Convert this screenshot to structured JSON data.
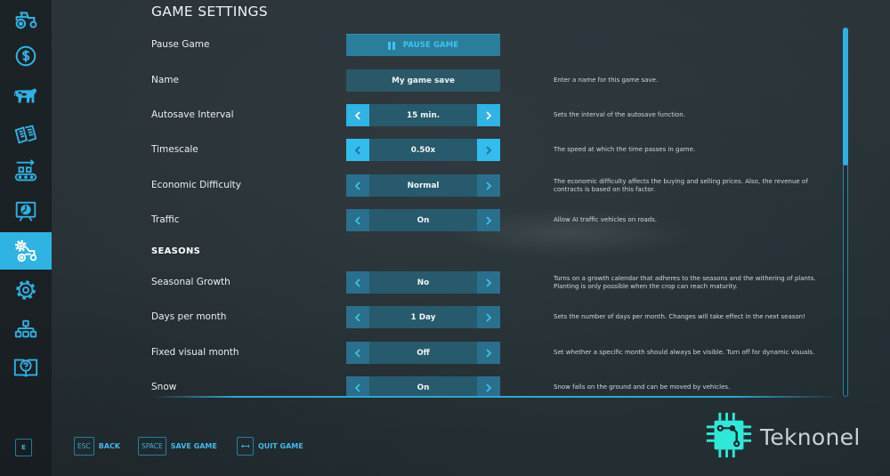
{
  "colors": {
    "accent": "#2fb4e4",
    "sidebar_bg": "#1a2024",
    "control_bg": "#265a6c",
    "watermark_accent": "#2ee8d8"
  },
  "sidebar": {
    "items": [
      {
        "id": "vehicles",
        "icon": "tractor-icon",
        "active": false
      },
      {
        "id": "finances",
        "icon": "dollar-icon",
        "active": false
      },
      {
        "id": "animals",
        "icon": "cow-icon",
        "active": false
      },
      {
        "id": "contracts",
        "icon": "papers-icon",
        "active": false
      },
      {
        "id": "production",
        "icon": "conveyor-icon",
        "active": false
      },
      {
        "id": "statistics",
        "icon": "presentation-icon",
        "active": false
      },
      {
        "id": "game-settings",
        "icon": "gear-tractor-icon",
        "active": true
      },
      {
        "id": "general-settings",
        "icon": "gear-icon",
        "active": false
      },
      {
        "id": "hierarchy",
        "icon": "hierarchy-icon",
        "active": false
      },
      {
        "id": "help",
        "icon": "help-book-icon",
        "active": false
      }
    ],
    "key_hint": "E"
  },
  "page": {
    "title": "GAME SETTINGS"
  },
  "settings": [
    {
      "id": "pause-game",
      "type": "button",
      "label": "Pause Game",
      "button_label": "PAUSE GAME",
      "icon": "pause-icon",
      "description": ""
    },
    {
      "id": "name",
      "type": "input",
      "label": "Name",
      "value": "My game save",
      "description": "Enter a name for this game save."
    },
    {
      "id": "autosave-interval",
      "type": "stepper",
      "state": "active",
      "label": "Autosave Interval",
      "value": "15 min.",
      "description": "Sets the interval of the autosave function."
    },
    {
      "id": "timescale",
      "type": "stepper",
      "state": "hover",
      "label": "Timescale",
      "value": "0.50x",
      "description": "The speed at which the time passes in game."
    },
    {
      "id": "economic-difficulty",
      "type": "stepper",
      "state": "normal",
      "label": "Economic Difficulty",
      "value": "Normal",
      "description": "The economic difficulty affects the buying and selling prices. Also, the revenue of contracts is based on this factor."
    },
    {
      "id": "traffic",
      "type": "stepper",
      "state": "normal",
      "label": "Traffic",
      "value": "On",
      "description": "Allow AI traffic vehicles on roads."
    },
    {
      "id": "seasons-header",
      "type": "header",
      "label": "SEASONS"
    },
    {
      "id": "seasonal-growth",
      "type": "stepper",
      "state": "normal",
      "label": "Seasonal Growth",
      "value": "No",
      "description": "Turns on a growth calendar that adheres to the seasons and the withering of plants. Planting is only possible when the crop can reach maturity."
    },
    {
      "id": "days-per-month",
      "type": "stepper",
      "state": "normal",
      "label": "Days per month",
      "value": "1 Day",
      "description": "Sets the number of days per month. Changes will take effect in the next season!"
    },
    {
      "id": "fixed-visual-month",
      "type": "stepper",
      "state": "normal",
      "label": "Fixed visual month",
      "value": "Off",
      "description": "Set whether a specific month should always be visible. Turn off for dynamic visuals."
    },
    {
      "id": "snow",
      "type": "stepper",
      "state": "normal",
      "label": "Snow",
      "value": "On",
      "description": "Snow falls on the ground and can be moved by vehicles."
    }
  ],
  "scrollbar": {
    "thumb_fraction": 0.37,
    "position_fraction": 0.0
  },
  "footer": {
    "back": {
      "key": "ESC",
      "label": "BACK"
    },
    "save": {
      "key": "SPACE",
      "label": "SAVE GAME"
    },
    "quit": {
      "key_icon": "exit-key-icon",
      "label": "QUIT GAME"
    }
  },
  "watermark": {
    "text": "Teknonel",
    "icon": "chip-icon"
  }
}
